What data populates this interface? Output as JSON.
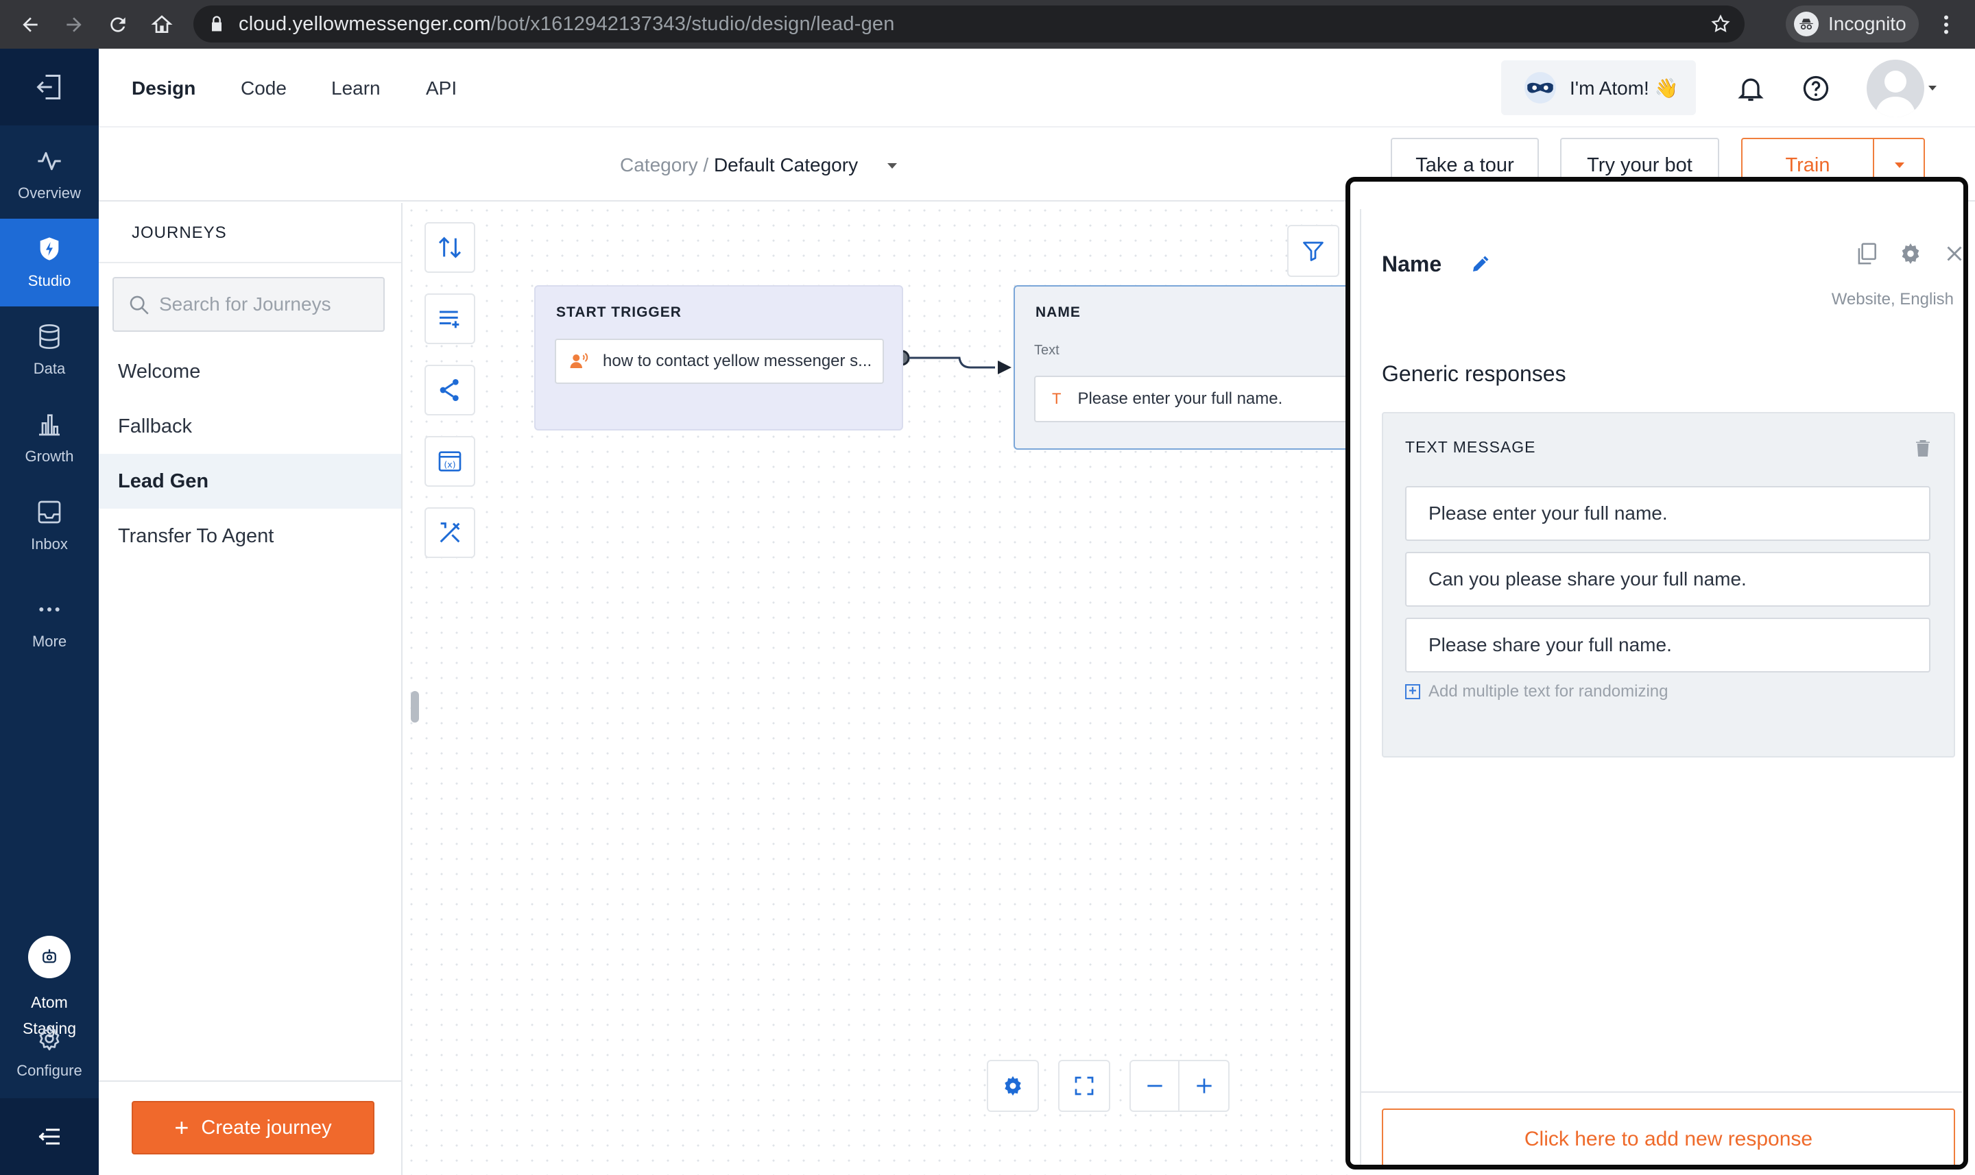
{
  "browser": {
    "url_host": "cloud.yellowmessenger.com",
    "url_path": "/bot/x1612942137343/studio/design/lead-gen",
    "incognito_label": "Incognito"
  },
  "sidebar": {
    "items": [
      {
        "label": "Overview",
        "icon": "pulse-icon"
      },
      {
        "label": "Studio",
        "icon": "shield-icon",
        "active": true
      },
      {
        "label": "Data",
        "icon": "database-icon"
      },
      {
        "label": "Growth",
        "icon": "bar-chart-icon"
      },
      {
        "label": "Inbox",
        "icon": "inbox-icon"
      },
      {
        "label": "More",
        "icon": "more-dots-icon"
      }
    ],
    "bot_name_line1": "Atom",
    "bot_name_line2": "Staging",
    "configure_label": "Configure"
  },
  "header": {
    "tabs": [
      "Design",
      "Code",
      "Learn",
      "API"
    ],
    "active_tab": "Design",
    "atom_label": "I'm Atom! 👋"
  },
  "subheader": {
    "category_prefix": "Category /",
    "category_value": "Default Category",
    "take_tour": "Take a tour",
    "try_bot": "Try your bot",
    "train": "Train"
  },
  "journeys": {
    "title": "JOURNEYS",
    "search_placeholder": "Search for Journeys",
    "items": [
      "Welcome",
      "Fallback",
      "Lead Gen",
      "Transfer To Agent"
    ],
    "active": "Lead Gen",
    "create_label": "Create journey"
  },
  "canvas": {
    "start_node": {
      "title": "START TRIGGER",
      "trigger_text": "how to contact yellow messenger s..."
    },
    "name_node": {
      "title": "NAME",
      "type": "Text",
      "type_icon_letter": "T",
      "text": "Please enter your full name."
    }
  },
  "panel": {
    "title": "Name",
    "meta": "Website, English",
    "section_title": "Generic responses",
    "card_title": "TEXT MESSAGE",
    "messages": [
      "Please enter your full name.",
      "Can you please share your full name.",
      "Please share your full name."
    ],
    "add_multiple": "Add multiple text for randomizing",
    "add_response": "Click here to add new response"
  },
  "colors": {
    "sidebar_bg": "#0e2a4f",
    "sidebar_active": "#1e6bd6",
    "accent_orange": "#f0692c",
    "accent_blue": "#3b7ddd"
  }
}
